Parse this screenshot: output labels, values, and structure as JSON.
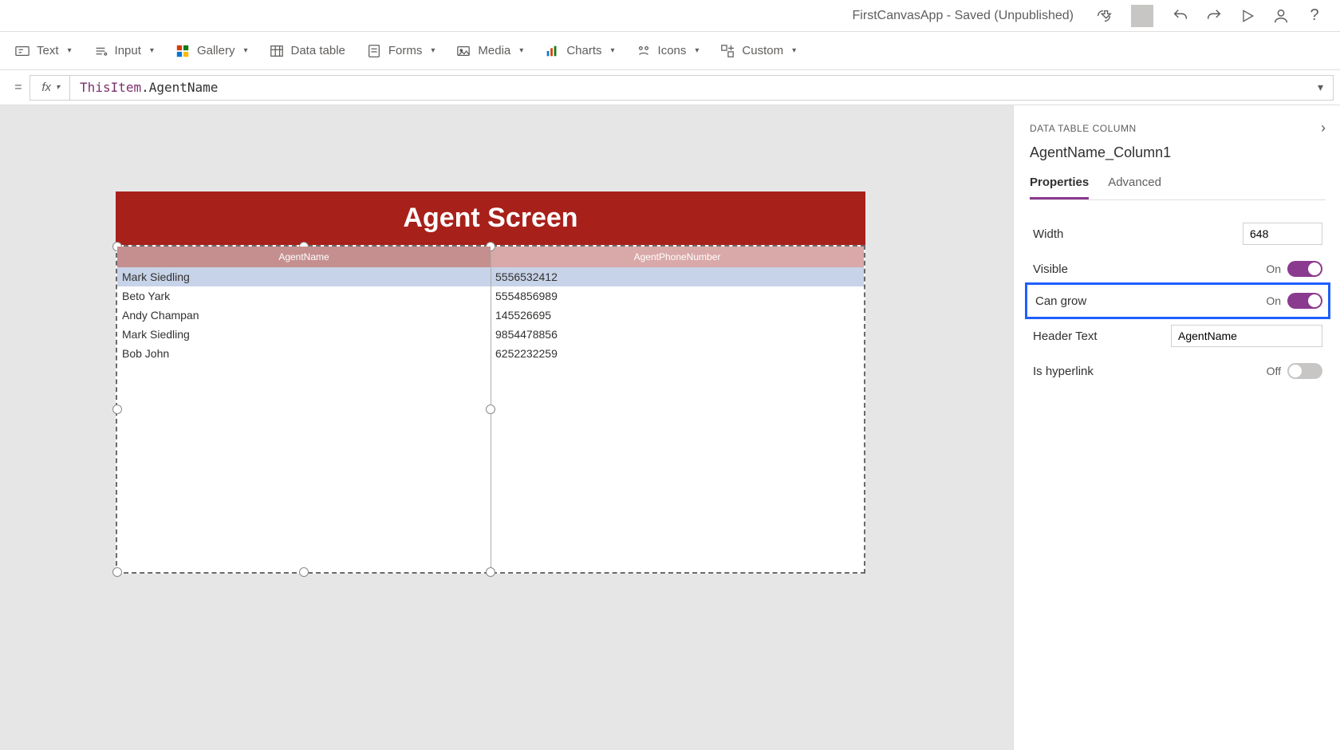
{
  "title_bar": {
    "app_title": "FirstCanvasApp - Saved (Unpublished)"
  },
  "ribbon": {
    "text_label": "Text",
    "input_label": "Input",
    "gallery_label": "Gallery",
    "data_table_label": "Data table",
    "forms_label": "Forms",
    "media_label": "Media",
    "charts_label": "Charts",
    "icons_label": "Icons",
    "custom_label": "Custom"
  },
  "formula": {
    "fx": "fx",
    "keyword": "ThisItem",
    "property": ".AgentName"
  },
  "canvas": {
    "header": "Agent Screen",
    "columns": [
      {
        "label": "AgentName"
      },
      {
        "label": "AgentPhoneNumber"
      }
    ],
    "rows": [
      {
        "name": "Mark Siedling",
        "phone": "5556532412"
      },
      {
        "name": "Beto Yark",
        "phone": "5554856989"
      },
      {
        "name": "Andy Champan",
        "phone": "145526695"
      },
      {
        "name": "Mark Siedling",
        "phone": "9854478856"
      },
      {
        "name": "Bob John",
        "phone": "6252232259"
      }
    ]
  },
  "properties": {
    "section_title": "DATA TABLE COLUMN",
    "column_name": "AgentName_Column1",
    "tabs": {
      "properties": "Properties",
      "advanced": "Advanced"
    },
    "width": {
      "label": "Width",
      "value": "648"
    },
    "visible": {
      "label": "Visible",
      "state": "On"
    },
    "can_grow": {
      "label": "Can grow",
      "state": "On"
    },
    "header_text": {
      "label": "Header Text",
      "value": "AgentName"
    },
    "is_hyperlink": {
      "label": "Is hyperlink",
      "state": "Off"
    }
  }
}
